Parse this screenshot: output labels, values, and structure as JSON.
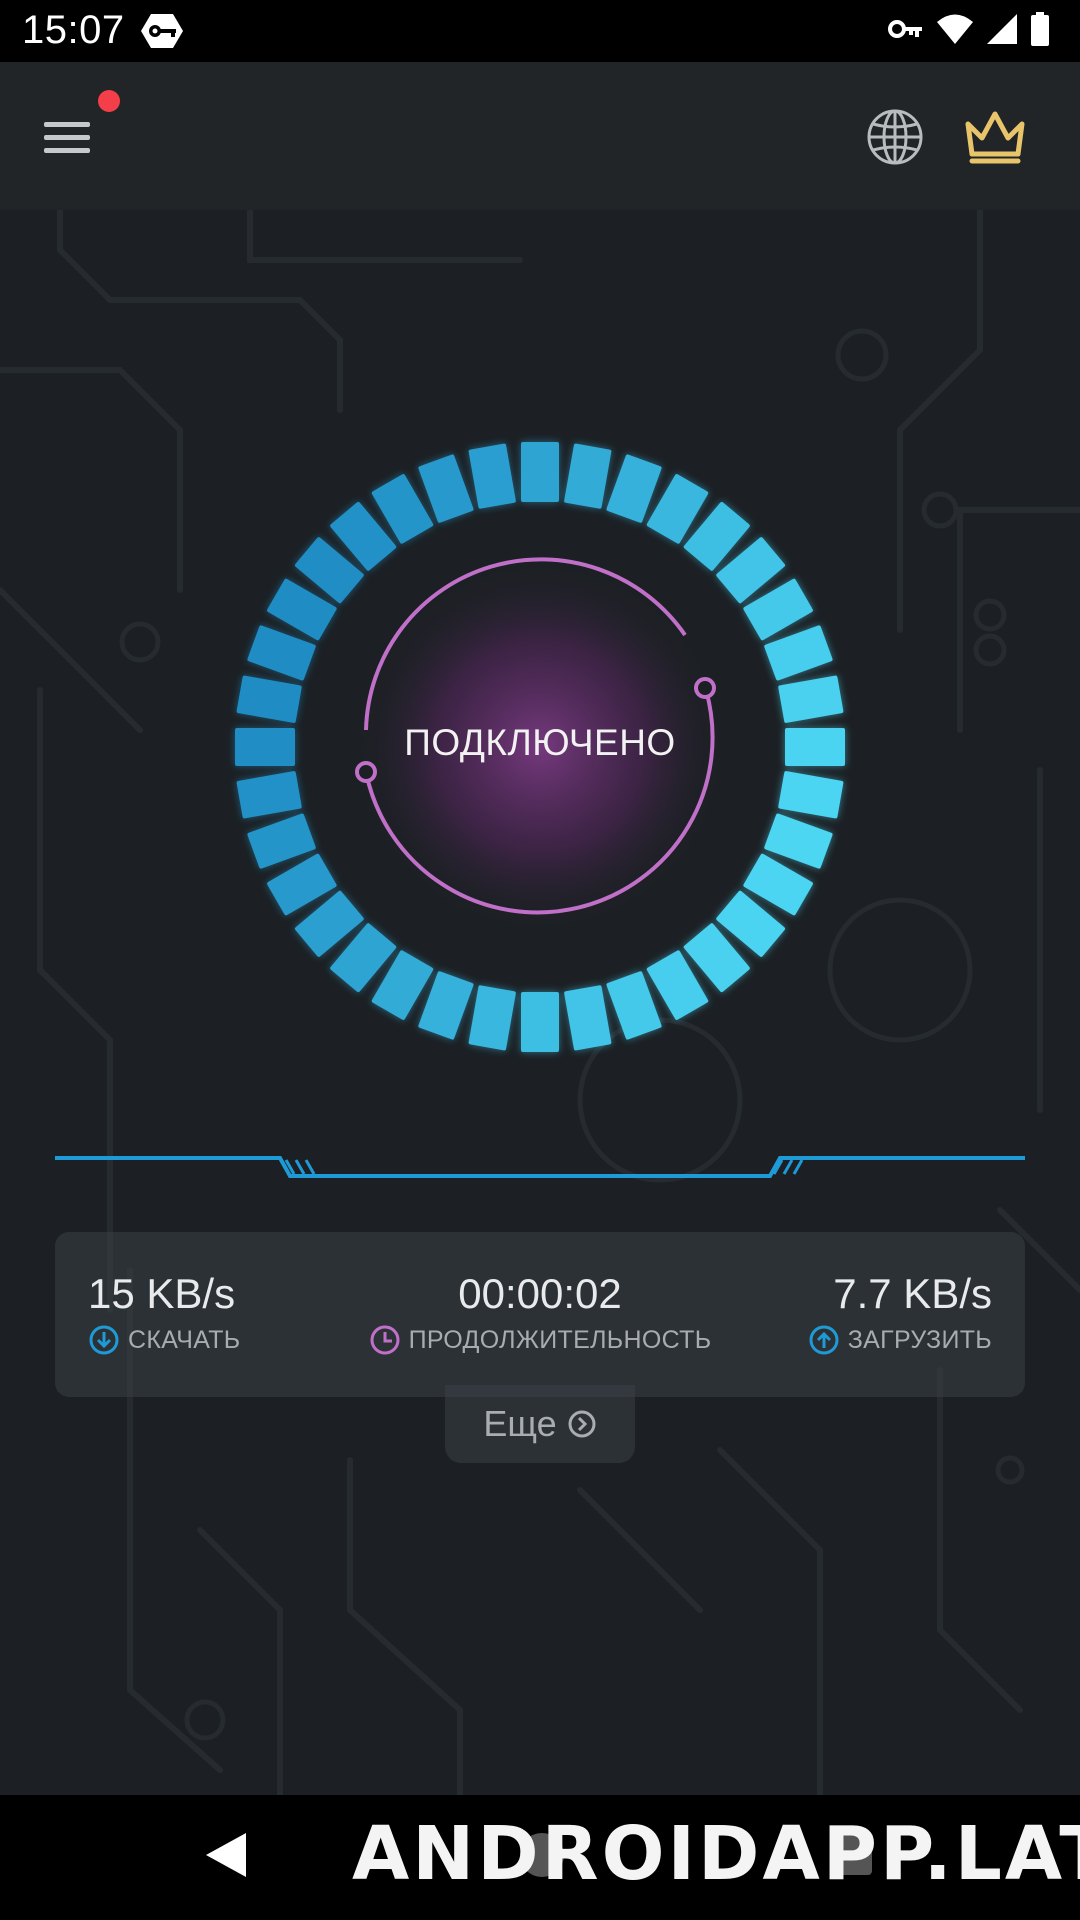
{
  "status_bar": {
    "time": "15:07",
    "icons": [
      "vpn-key-badge-icon",
      "key-icon",
      "wifi-icon",
      "cell-signal-icon",
      "battery-icon"
    ]
  },
  "app_bar": {
    "menu_icon": "hamburger-menu-icon",
    "has_notification": true,
    "globe_icon": "globe-icon",
    "crown_icon": "crown-icon"
  },
  "connection": {
    "status": "ПОДКЛЮЧЕНО",
    "colors": {
      "ring": "#3fc4ea",
      "arc": "#c464c8",
      "glow": "#7a3a82"
    }
  },
  "stats": {
    "download": {
      "value": "15 KB/s",
      "label": "СКАЧАТЬ",
      "icon": "download-arrow-icon"
    },
    "duration": {
      "value": "00:00:02",
      "label": "ПРОДОЛЖИТЕЛЬНОСТЬ",
      "icon": "clock-icon"
    },
    "upload": {
      "value": "7.7 KB/s",
      "label": "ЗАГРУЗИТЬ",
      "icon": "upload-arrow-icon"
    }
  },
  "more": {
    "label": "Еще",
    "icon": "chevron-circle-right-icon"
  },
  "watermark": "ANDROIDAPP.LAT",
  "colors": {
    "accent_blue": "#29a6dc",
    "accent_purple": "#c070c8",
    "app_bar_bg": "#212528",
    "main_bg": "#1c2024",
    "crown": "#e8c46a"
  }
}
